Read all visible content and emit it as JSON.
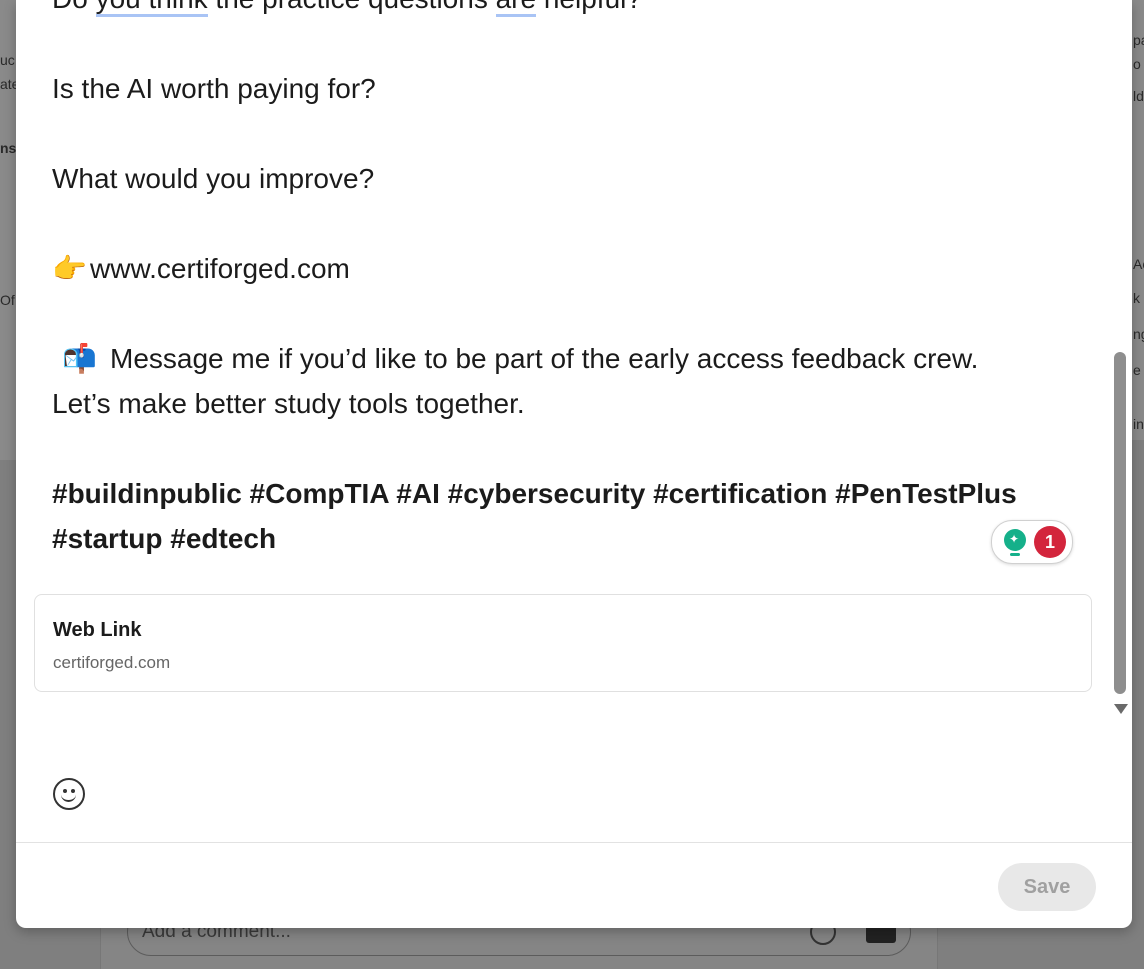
{
  "background": {
    "left_fragments": [
      "uc",
      "ate",
      "ns",
      "Of"
    ],
    "right_fragments": [
      "pa",
      "o",
      "ld",
      "Ac",
      "k",
      "ng",
      "e",
      "in"
    ],
    "comment_placeholder": "Add a comment..."
  },
  "post": {
    "line_partial": "Do you think the practice questions are helpful?",
    "line_partial_parts": [
      "Do ",
      "you think",
      " the practice questions ",
      "are",
      " helpful?"
    ],
    "question_ai": "Is the AI worth paying for?",
    "question_improve": "What would you improve?",
    "link_emoji": "👉",
    "link_text": "www.certiforged.com",
    "message_emoji": "📬",
    "message_line1": "Message me if you’d like to be part of the early access feedback crew.",
    "message_line2": "Let’s make better study tools together.",
    "hashtags_line1": "#buildinpublic #CompTIA #AI #cybersecurity #certification #PenTestPlus",
    "hashtags_line2": "#startup #edtech"
  },
  "grammar_badge": {
    "count": "1",
    "icon": "lightbulb-icon"
  },
  "link_preview": {
    "title": "Web Link",
    "domain": "certiforged.com"
  },
  "footer": {
    "save_label": "Save"
  },
  "colors": {
    "accent_red": "#d3253c",
    "accent_green": "#15b08a",
    "underline_blue": "#a9c4f5",
    "save_disabled_bg": "#e8e8e8"
  }
}
